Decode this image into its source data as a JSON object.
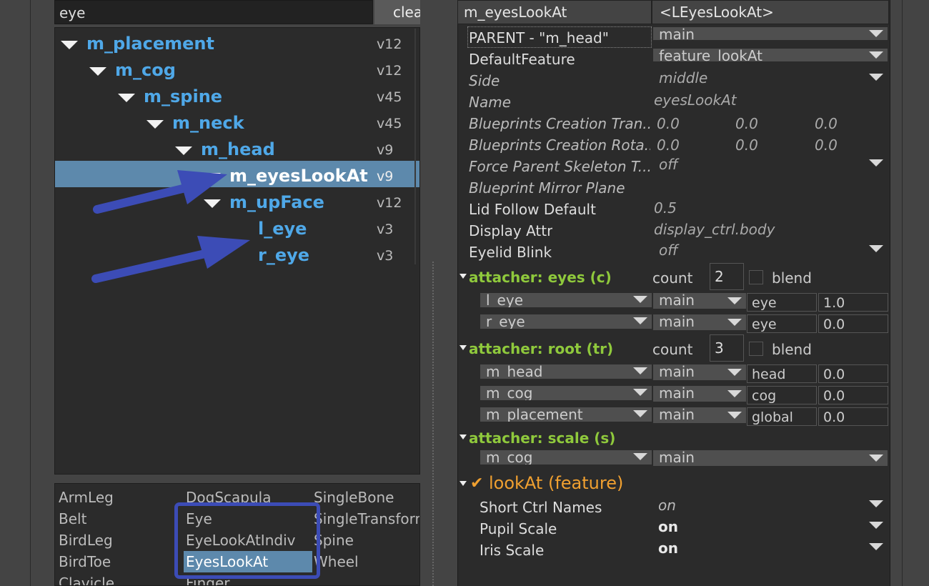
{
  "search": {
    "value": "eye",
    "clear_label": "clea"
  },
  "tree": {
    "rows": [
      {
        "name": "m_placement",
        "version": "v12"
      },
      {
        "name": "m_cog",
        "version": "v12"
      },
      {
        "name": "m_spine",
        "version": "v45"
      },
      {
        "name": "m_neck",
        "version": "v45"
      },
      {
        "name": "m_head",
        "version": "v9"
      },
      {
        "name": "m_eyesLookAt",
        "version": "v9"
      },
      {
        "name": "m_upFace",
        "version": "v12"
      },
      {
        "name": "l_eye",
        "version": "v3"
      },
      {
        "name": "r_eye",
        "version": "v3"
      }
    ]
  },
  "library": {
    "col1": [
      "ArmLeg",
      "Belt",
      "BirdLeg",
      "BirdToe",
      "Clavicle"
    ],
    "col2": [
      "DogScapula",
      "Eye",
      "EyeLookAtIndiv",
      "EyesLookAt",
      "Finger"
    ],
    "col3": [
      "SingleBone",
      "SingleTransform",
      "Spine",
      "Wheel"
    ]
  },
  "header": {
    "component": "m_eyesLookAt",
    "type": "<LEyesLookAt>"
  },
  "props": {
    "parent_label": "PARENT - \"m_head\"",
    "parent_value": "main",
    "default_feature_label": "DefaultFeature",
    "default_feature_value": "feature_lookAt",
    "side_label": "Side",
    "side_value": "middle",
    "name_label": "Name",
    "name_value": "eyesLookAt",
    "bp_trans_label": "Blueprints Creation Tran...",
    "bp_trans_values": [
      "0.0",
      "0.0",
      "0.0"
    ],
    "bp_rot_label": "Blueprints Creation Rota...",
    "bp_rot_values": [
      "0.0",
      "0.0",
      "0.0"
    ],
    "force_parent_label": "Force Parent Skeleton T...",
    "force_parent_value": "off",
    "mirror_plane_label": "Blueprint Mirror Plane",
    "lid_follow_label": "Lid Follow Default",
    "lid_follow_value": "0.5",
    "display_attr_label": "Display Attr",
    "display_attr_value": "display_ctrl.body",
    "eyelid_blink_label": "Eyelid Blink",
    "eyelid_blink_value": "off"
  },
  "attachers": {
    "count_label": "count",
    "blend_label": "blend",
    "eyes": {
      "title": "attacher: eyes (c)",
      "count": "2",
      "rows": [
        {
          "target": "l_eye",
          "space": "main",
          "name": "eye",
          "weight": "1.0"
        },
        {
          "target": "r_eye",
          "space": "main",
          "name": "eye",
          "weight": "0.0"
        }
      ]
    },
    "root": {
      "title": "attacher: root (tr)",
      "count": "3",
      "rows": [
        {
          "target": "m_head",
          "space": "main",
          "name": "head",
          "weight": "0.0"
        },
        {
          "target": "m_cog",
          "space": "main",
          "name": "cog",
          "weight": "0.0"
        },
        {
          "target": "m_placement",
          "space": "main",
          "name": "global",
          "weight": "0.0"
        }
      ]
    },
    "scale": {
      "title": "attacher: scale (s)",
      "target": "m_cog",
      "space": "main"
    }
  },
  "feature": {
    "check": "✔",
    "title": "lookAt (feature)",
    "rows": [
      {
        "label": "Short Ctrl Names",
        "value": "on"
      },
      {
        "label": "Pupil Scale",
        "value": "on"
      },
      {
        "label": "Iris Scale",
        "value": "on"
      }
    ]
  },
  "colors": {
    "accent_blue": "#4fa8e8",
    "selection": "#5d89ac",
    "section_green": "#8fc93c",
    "feature_orange": "#f0a030",
    "annotation": "#3c4cb6"
  }
}
